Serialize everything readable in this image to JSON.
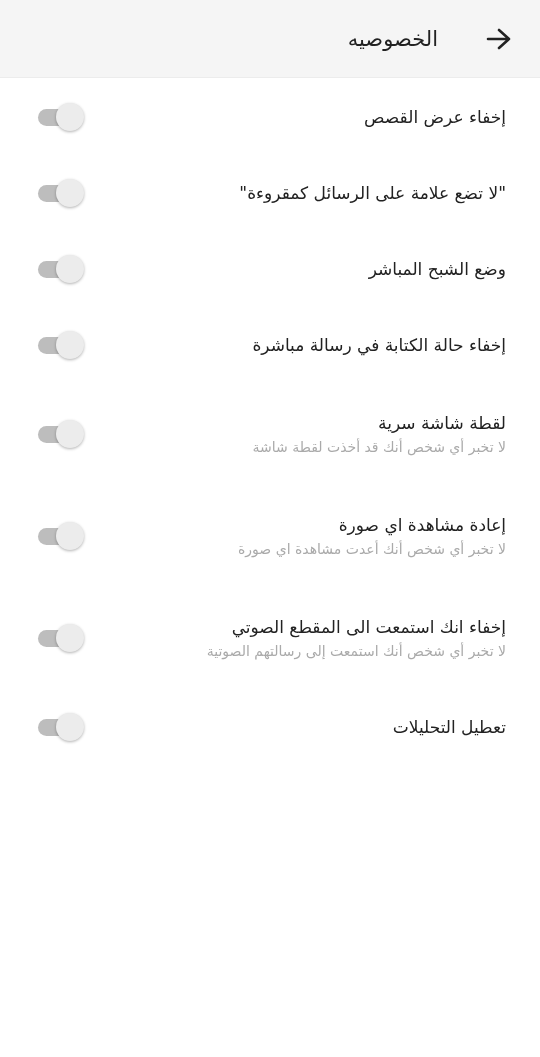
{
  "header": {
    "title": "الخصوصيه"
  },
  "settings": [
    {
      "label": "إخفاء عرض القصص",
      "on": false
    },
    {
      "label": "\"لا تضع علامة على الرسائل كمقروءة\"",
      "on": false
    },
    {
      "label": "وضع الشبح المباشر",
      "on": false
    },
    {
      "label": "إخفاء حالة الكتابة في رسالة مباشرة",
      "on": false
    },
    {
      "label": "لقطة شاشة سرية",
      "description": "لا تخبر أي شخص أنك قد أخذت لقطة شاشة",
      "on": false
    },
    {
      "label": "إعادة مشاهدة اي صورة",
      "description": "لا تخبر أي شخص أنك أعدت مشاهدة اي صورة",
      "on": false
    },
    {
      "label": "إخفاء انك استمعت الى المقطع الصوتي",
      "description": "لا تخبر أي شخص أنك استمعت إلى رسالتهم الصوتية",
      "on": false
    },
    {
      "label": "تعطيل التحليلات",
      "on": false
    }
  ]
}
